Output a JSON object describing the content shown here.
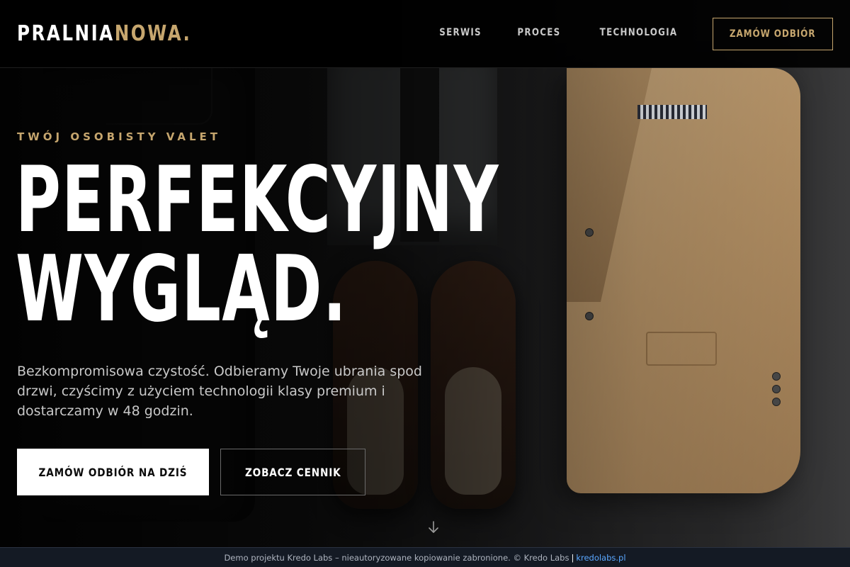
{
  "header": {
    "logo_primary": "PRALNIA",
    "logo_accent": "NOWA.",
    "nav": [
      {
        "label": "SERWIS"
      },
      {
        "label": "PROCES"
      },
      {
        "label": "TECHNOLOGIA"
      }
    ],
    "cta_label": "ZAMÓW ODBIÓR"
  },
  "hero": {
    "eyebrow": "TWÓJ OSOBISTY VALET",
    "headline_line1": "PERFEKCYJNY",
    "headline_line2": "WYGLĄD.",
    "lead": "Bezkompromisowa czystość. Odbieramy Twoje ubrania spod drzwi, czyścimy z użyciem technologii klasy premium i dostarczamy w 48 godzin.",
    "primary_button": "ZAMÓW ODBIÓR NA DZIŚ",
    "secondary_button": "ZOBACZ CENNIK",
    "scroll_icon": "arrow-down-icon"
  },
  "footer": {
    "notice": "Demo projektu Kredo Labs – nieautoryzowane kopiowanie zabronione. © Kredo Labs",
    "separator": "|",
    "link_label": "kredolabs.pl"
  },
  "colors": {
    "accent_gold": "#c6a66e",
    "background": "#0b0b0b",
    "footer_bg": "#141a24",
    "footer_link": "#5aa7ff"
  }
}
